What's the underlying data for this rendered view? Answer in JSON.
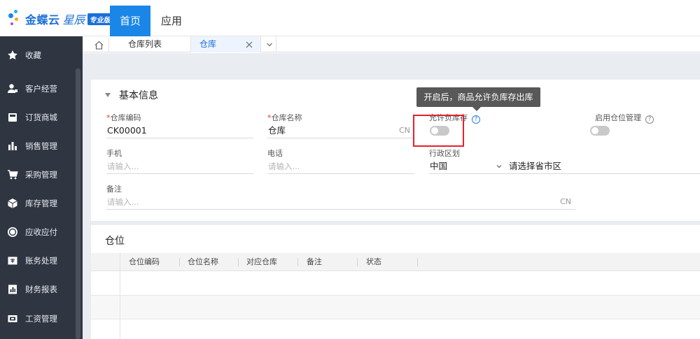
{
  "header": {
    "logo_text": "金蝶云",
    "logo_sub": "星辰",
    "logo_badge": "专业版",
    "tabs": [
      {
        "label": "首页",
        "active": true
      },
      {
        "label": "应用",
        "active": false
      }
    ]
  },
  "sidebar": {
    "items": [
      {
        "label": "收藏",
        "icon": "star-icon"
      },
      {
        "label": "客户经营",
        "icon": "customer-icon"
      },
      {
        "label": "订货商城",
        "icon": "store-icon"
      },
      {
        "label": "销售管理",
        "icon": "chart-bars-icon"
      },
      {
        "label": "采购管理",
        "icon": "cart-icon"
      },
      {
        "label": "库存管理",
        "icon": "box-icon"
      },
      {
        "label": "应收应付",
        "icon": "coin-icon"
      },
      {
        "label": "账务处理",
        "icon": "voucher-icon"
      },
      {
        "label": "财务报表",
        "icon": "report-icon"
      },
      {
        "label": "工资管理",
        "icon": "wallet-icon"
      }
    ]
  },
  "tabbar": {
    "tabs": [
      {
        "label": "仓库列表",
        "active": false
      },
      {
        "label": "仓库",
        "active": true
      }
    ]
  },
  "basic": {
    "title": "基本信息",
    "code": {
      "label": "仓库编码",
      "value": "CK00001"
    },
    "name": {
      "label": "仓库名称",
      "value": "仓库",
      "suffix": "CN"
    },
    "allow_negative": {
      "label": "允许负库存",
      "enabled": false
    },
    "enable_location": {
      "label": "启用仓位管理",
      "enabled": false
    },
    "phone": {
      "label": "手机",
      "placeholder": "请输入..."
    },
    "tel": {
      "label": "电话",
      "placeholder": "请输入..."
    },
    "region": {
      "label": "行政区划",
      "country": "中国",
      "province_placeholder": "请选择省市区"
    },
    "remark": {
      "label": "备注",
      "placeholder": "请输入...",
      "suffix": "CN"
    }
  },
  "tooltip": "开启后，商品允许负库存出库",
  "location": {
    "title": "仓位",
    "columns": [
      "仓位编码",
      "仓位名称",
      "对应仓库",
      "备注",
      "状态"
    ]
  },
  "colors": {
    "primary": "#1a86e8",
    "sidebar_bg": "#2f3541",
    "required": "#e03a3a",
    "highlight_box": "#e5212b"
  }
}
